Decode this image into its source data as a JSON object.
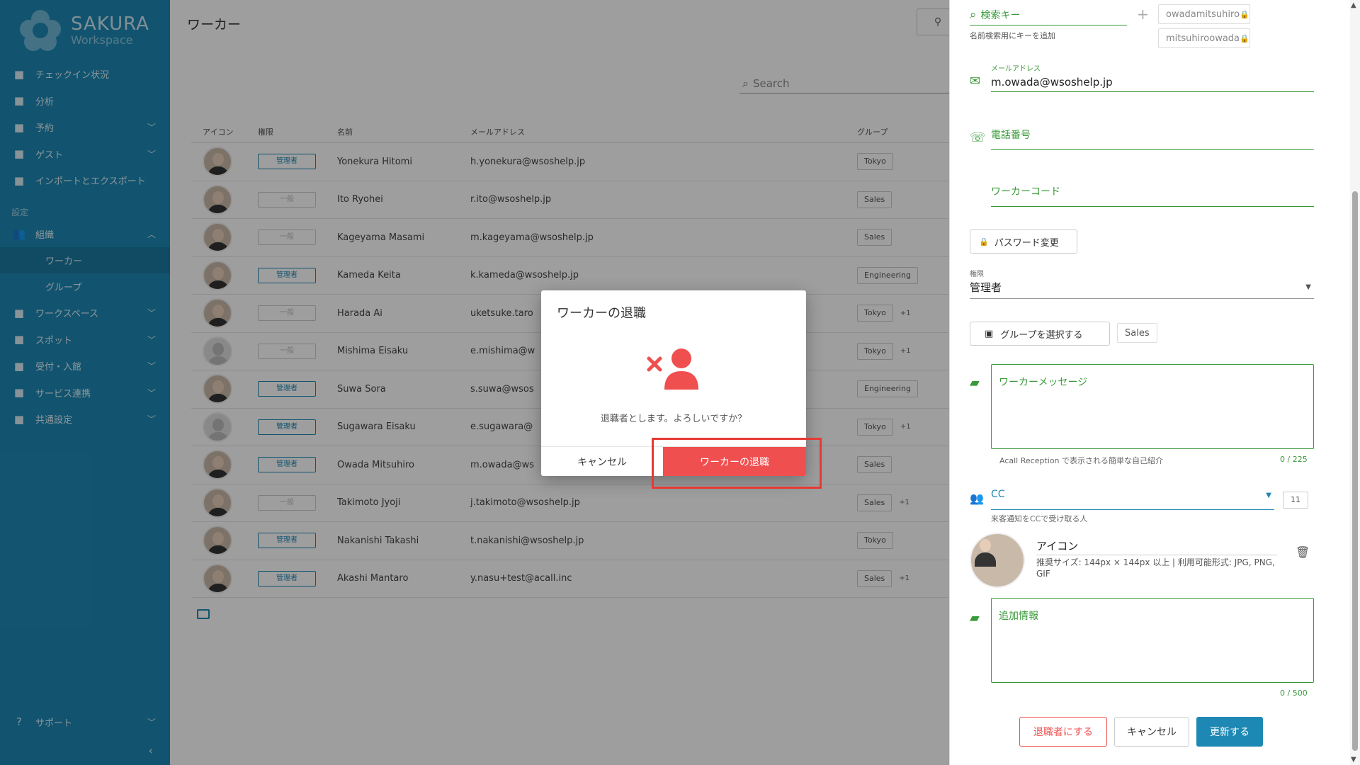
{
  "sidebar": {
    "logo_title": "SAKURA",
    "logo_sub": "Workspace",
    "items": [
      {
        "label": "チェックイン状況",
        "icon": "checkbox-icon",
        "chevron": false
      },
      {
        "label": "分析",
        "icon": "chart-icon",
        "chevron": false
      },
      {
        "label": "予約",
        "icon": "calendar-icon",
        "chevron": true
      },
      {
        "label": "ゲスト",
        "icon": "guest-icon",
        "chevron": true
      },
      {
        "label": "インポートとエクスポート",
        "icon": "import-export-icon",
        "chevron": false
      }
    ],
    "section_label": "設定",
    "org_label": "組織",
    "sub_items": [
      "ワーカー",
      "グループ"
    ],
    "items2": [
      {
        "label": "ワークスペース",
        "icon": "location-pin-icon"
      },
      {
        "label": "スポット",
        "icon": "spot-pin-icon"
      },
      {
        "label": "受付・入館",
        "icon": "reception-icon"
      },
      {
        "label": "サービス連携",
        "icon": "integration-icon"
      },
      {
        "label": "共通設定",
        "icon": "settings-icon"
      }
    ],
    "support_label": "サポート"
  },
  "main": {
    "title": "ワーカー",
    "search_placeholder": "Search",
    "columns": [
      "アイコン",
      "権限",
      "名前",
      "メールアドレス",
      "グループ"
    ],
    "rows": [
      {
        "role": "管理者",
        "role_type": "admin",
        "name": "Yonekura Hitomi",
        "email": "h.yonekura@wsoshelp.jp",
        "group": "Tokyo",
        "extra": ""
      },
      {
        "role": "一般",
        "role_type": "general",
        "name": "Ito Ryohei",
        "email": "r.ito@wsoshelp.jp",
        "group": "Sales",
        "extra": ""
      },
      {
        "role": "一般",
        "role_type": "general",
        "name": "Kageyama Masami",
        "email": "m.kageyama@wsoshelp.jp",
        "group": "Sales",
        "extra": ""
      },
      {
        "role": "管理者",
        "role_type": "admin",
        "name": "Kameda Keita",
        "email": "k.kameda@wsoshelp.jp",
        "group": "Engineering",
        "extra": ""
      },
      {
        "role": "一般",
        "role_type": "general",
        "name": "Harada Ai",
        "email": "uketsuke.taro",
        "group": "Tokyo",
        "extra": "+1"
      },
      {
        "role": "一般",
        "role_type": "general",
        "name": "Mishima Eisaku",
        "email": "e.mishima@w",
        "group": "Tokyo",
        "extra": "+1",
        "no_photo": true
      },
      {
        "role": "管理者",
        "role_type": "admin",
        "name": "Suwa Sora",
        "email": "s.suwa@wsos",
        "group": "Engineering",
        "extra": ""
      },
      {
        "role": "管理者",
        "role_type": "admin",
        "name": "Sugawara Eisaku",
        "email": "e.sugawara@",
        "group": "Tokyo",
        "extra": "+1",
        "no_photo": true
      },
      {
        "role": "管理者",
        "role_type": "admin",
        "name": "Owada Mitsuhiro",
        "email": "m.owada@ws",
        "group": "Sales",
        "extra": ""
      },
      {
        "role": "一般",
        "role_type": "general",
        "name": "Takimoto Jyoji",
        "email": "j.takimoto@wsoshelp.jp",
        "group": "Sales",
        "extra": "+1"
      },
      {
        "role": "管理者",
        "role_type": "admin",
        "name": "Nakanishi Takashi",
        "email": "t.nakanishi@wsoshelp.jp",
        "group": "Tokyo",
        "extra": ""
      },
      {
        "role": "管理者",
        "role_type": "admin",
        "name": "Akashi Mantaro",
        "email": "y.nasu+test@acall.inc",
        "group": "Sales",
        "extra": "+1"
      }
    ]
  },
  "panel": {
    "search_key_label": "検索キー",
    "search_key_help": "名前検索用にキーを追加",
    "key_chips": [
      "owadamitsuhiro",
      "mitsuhiroowada"
    ],
    "email_label": "メールアドレス",
    "email_value": "m.owada@wsoshelp.jp",
    "phone_label": "電話番号",
    "worker_code_label": "ワーカーコード",
    "password_button": "パスワード変更",
    "role_label": "権限",
    "role_value": "管理者",
    "group_button": "グループを選択する",
    "group_chip": "Sales",
    "message_placeholder": "ワーカーメッセージ",
    "message_help": "Acall Reception で表示される簡単な自己紹介",
    "message_count": "0 / 225",
    "cc_label": "CC",
    "cc_count": "11",
    "cc_help": "来客通知をCCで受け取る人",
    "icon_label": "アイコン",
    "icon_help": "推奨サイズ: 144px × 144px 以上 | 利用可能形式: JPG, PNG, GIF",
    "extra_placeholder": "追加情報",
    "extra_count": "0 / 500",
    "retire_button": "退職者にする",
    "cancel_button": "キャンセル",
    "update_button": "更新する"
  },
  "modal": {
    "title": "ワーカーの退職",
    "message": "退職者とします。よろしいですか？",
    "cancel": "キャンセル",
    "confirm": "ワーカーの退職"
  },
  "colors": {
    "brand": "#1e88b4",
    "danger": "#f04f4f",
    "green": "#3a9a3a"
  }
}
